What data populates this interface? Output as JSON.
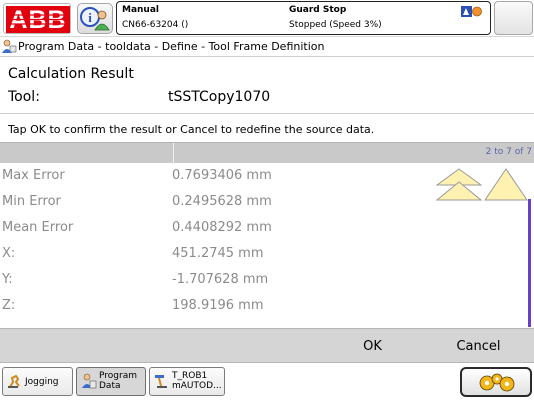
{
  "status": {
    "mode": "Manual",
    "controller": "CN66-63204 ()",
    "state": "Guard Stop",
    "run_state": "Stopped (Speed 3%)"
  },
  "breadcrumb": "Program Data - tooldata - Define - Tool Frame Definition",
  "page": {
    "title": "Calculation Result",
    "tool_label": "Tool:",
    "tool_value": "tSSTCopy1070",
    "instruction": "Tap OK to confirm the result or Cancel to redefine the source data."
  },
  "table": {
    "range_label": "2 to 7 of 7",
    "rows": [
      {
        "name": "Max Error",
        "value": "0.7693406 mm"
      },
      {
        "name": "Min Error",
        "value": "0.2495628 mm"
      },
      {
        "name": "Mean Error",
        "value": "0.4408292 mm"
      },
      {
        "name": "X:",
        "value": "451.2745 mm"
      },
      {
        "name": "Y:",
        "value": "-1.707628 mm"
      },
      {
        "name": "Z:",
        "value": "198.9196 mm"
      }
    ]
  },
  "actions": {
    "ok": "OK",
    "cancel": "Cancel"
  },
  "taskbar": {
    "jogging": "Jogging",
    "program_data_line1": "Program",
    "program_data_line2": "Data",
    "task_line1": "T_ROB1",
    "task_line2": "mAUTOD..."
  },
  "icons": {
    "logo": "abb-logo",
    "info": "info-person-icon",
    "breadcrumb": "program-data-icon",
    "scroll_up": "scroll-up-arrows",
    "quickset": "quickset-gears-icon"
  },
  "colors": {
    "abb_red": "#e2000f",
    "scroll_accent": "#6a3fc5",
    "arrow_yellow": "#fff2b0"
  }
}
